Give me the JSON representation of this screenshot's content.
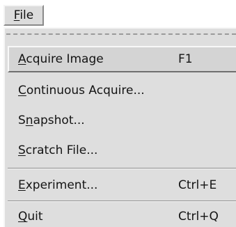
{
  "menubar": {
    "file": {
      "pre": "",
      "mnemonic": "F",
      "post": "ile"
    }
  },
  "menu": {
    "items": [
      {
        "pre": "",
        "mnemonic": "A",
        "post": "cquire Image",
        "accel": "F1"
      },
      {
        "pre": "",
        "mnemonic": "C",
        "post": "ontinuous Acquire...",
        "accel": ""
      },
      {
        "pre": "S",
        "mnemonic": "n",
        "post": "apshot...",
        "accel": ""
      },
      {
        "pre": "",
        "mnemonic": "S",
        "post": "cratch File...",
        "accel": ""
      },
      {
        "pre": "",
        "mnemonic": "E",
        "post": "xperiment...",
        "accel": "Ctrl+E"
      },
      {
        "pre": "",
        "mnemonic": "Q",
        "post": "uit",
        "accel": "Ctrl+Q"
      }
    ]
  }
}
